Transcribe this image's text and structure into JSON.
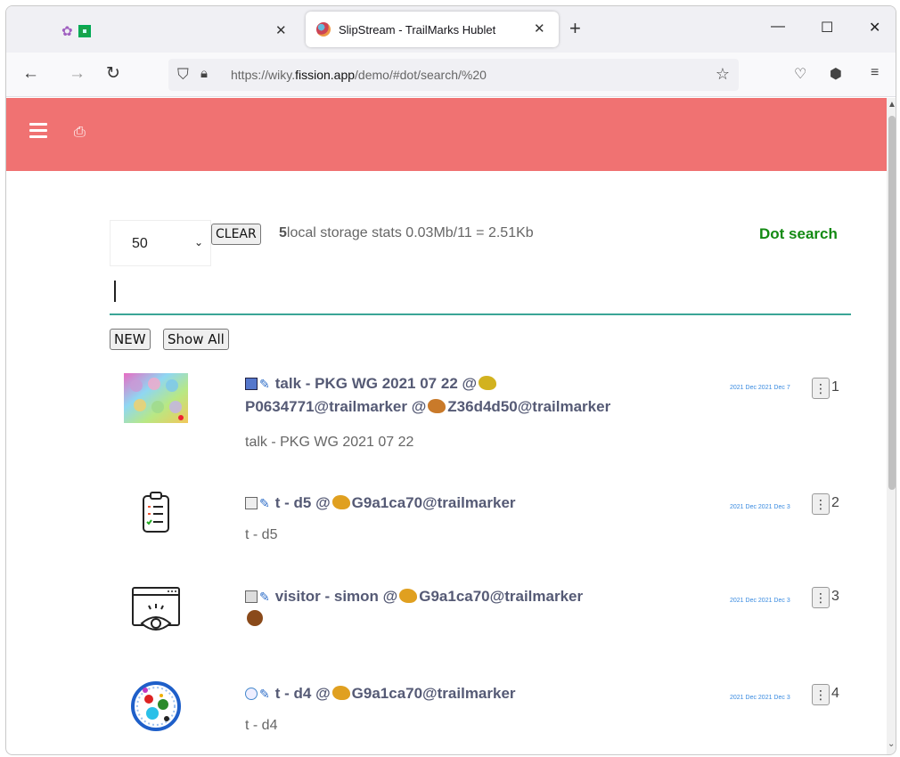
{
  "browser": {
    "tabs": [
      {
        "title": "",
        "icons": [
          "flower-app-icon",
          "green-square-app-icon"
        ]
      },
      {
        "title": "SlipStream - TrailMarks Hublet",
        "active": true
      }
    ],
    "new_tab": "+",
    "url_prefix": "https://wiky.",
    "url_domain": "fission.app",
    "url_suffix": "/demo/#dot/search/%20",
    "window_controls": {
      "minimize": "—",
      "maximize": "☐",
      "close": "✕"
    }
  },
  "toolbar": {
    "page_size": "50",
    "clear_label": "CLEAR",
    "count": "5",
    "stats_text": "local storage stats  0.03Mb/11 = 2.51Kb",
    "mode_label": "Dot search",
    "search_value": "",
    "new_label": "NEW",
    "show_all_label": "Show All"
  },
  "items": [
    {
      "title_line1": "talk - PKG WG 2021 07 22 @",
      "title_line2a": "P0634771@trailmarker @",
      "title_line2b": "Z36d4d50@trailmarker",
      "subtitle": "talk - PKG WG 2021 07 22",
      "date": "2021 Dec 2021 Dec 7",
      "index": "1"
    },
    {
      "title": "t - d5 @",
      "title_tail": "G9a1ca70@trailmarker",
      "subtitle": "t - d5",
      "date": "2021 Dec 2021 Dec 3",
      "index": "2"
    },
    {
      "title": "visitor - simon @",
      "title_tail": "G9a1ca70@trailmarker",
      "subtitle": "",
      "date": "2021 Dec 2021 Dec 3",
      "index": "3"
    },
    {
      "title": "t - d4 @",
      "title_tail": "G9a1ca70@trailmarker",
      "subtitle": "t - d4",
      "date": "2021 Dec 2021 Dec 3",
      "index": "4"
    }
  ],
  "colors": {
    "appbar": "#f07272",
    "dot_search": "#138a13",
    "title_text": "#555a75",
    "date_text": "#3a8be0",
    "underline": "#3aa596"
  }
}
